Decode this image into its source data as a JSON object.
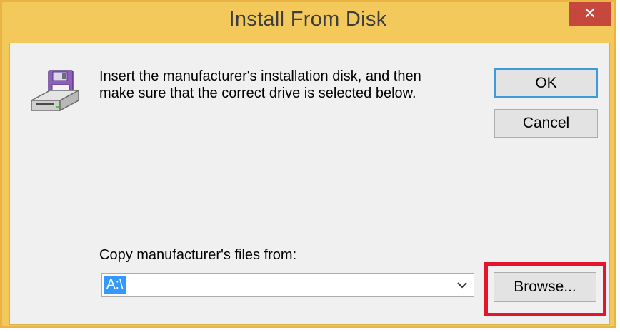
{
  "window": {
    "title": "Install From Disk",
    "close_glyph": "✕"
  },
  "dialog": {
    "icon": "floppy-disk-drive-icon",
    "message": "Insert the manufacturer's installation disk, and then\nmake sure that the correct drive is selected below.",
    "ok_label": "OK",
    "cancel_label": "Cancel",
    "copy_from_label": "Copy manufacturer's files from:",
    "path_value": "A:\\",
    "browse_label": "Browse..."
  },
  "colors": {
    "title_bar": "#f2c95a",
    "close_button": "#c6473b",
    "selection": "#3399ff",
    "highlight": "#e3142b",
    "default_button_border": "#3c9bd8"
  }
}
